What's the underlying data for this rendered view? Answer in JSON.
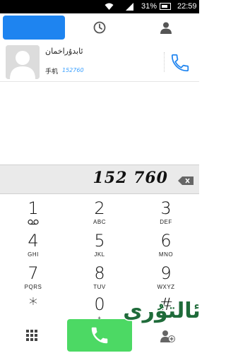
{
  "status_bar": {
    "battery_percent": "31%",
    "time": "22:59"
  },
  "tabs": [
    {
      "name": "dialer",
      "icon": "dialpad-tab"
    },
    {
      "name": "recent",
      "icon": "clock-icon"
    },
    {
      "name": "contacts",
      "icon": "person-icon"
    }
  ],
  "result": {
    "name": "ئابدۇراخمان",
    "type_label": "手机",
    "number": "152760"
  },
  "display": {
    "entered_number": "152 760"
  },
  "keypad": {
    "keys": [
      {
        "digit": "1",
        "letters": ""
      },
      {
        "digit": "2",
        "letters": "ABC"
      },
      {
        "digit": "3",
        "letters": "DEF"
      },
      {
        "digit": "4",
        "letters": "GHI"
      },
      {
        "digit": "5",
        "letters": "JKL"
      },
      {
        "digit": "6",
        "letters": "MNO"
      },
      {
        "digit": "7",
        "letters": "PQRS"
      },
      {
        "digit": "8",
        "letters": "TUV"
      },
      {
        "digit": "9",
        "letters": "WXYZ"
      },
      {
        "digit": "*",
        "letters": ""
      },
      {
        "digit": "0",
        "letters": "+"
      },
      {
        "digit": "#",
        "letters": ""
      }
    ]
  },
  "colors": {
    "accent": "#1e84f0",
    "call_green": "#4cd964",
    "number_blue": "#3aa0ff"
  },
  "watermark": {
    "text": "ئالتۇرى"
  }
}
